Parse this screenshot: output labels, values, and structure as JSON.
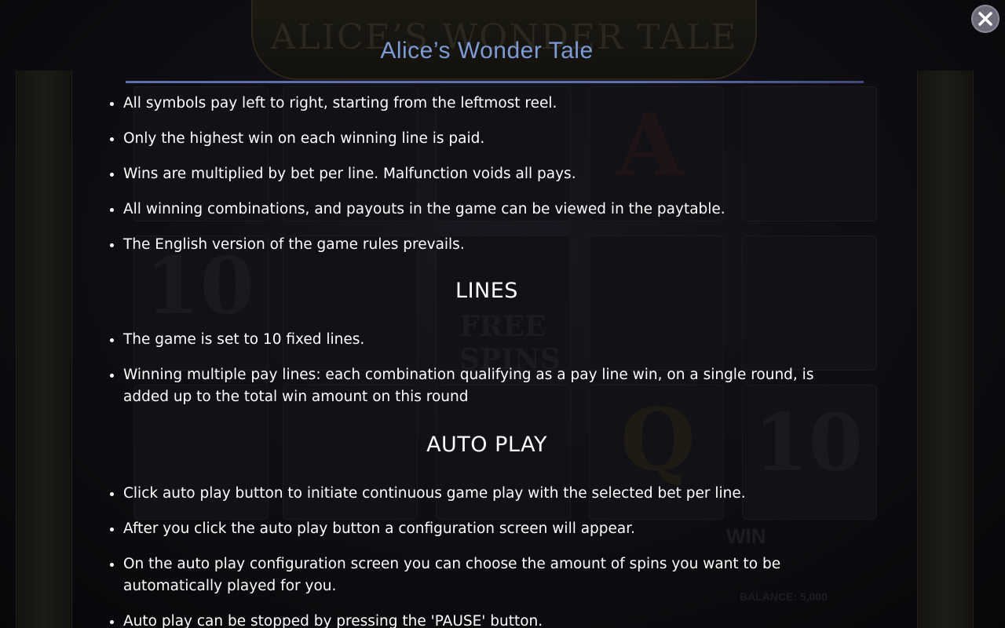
{
  "window": {
    "title": "Alice’s Wonder Tale"
  },
  "icons": {
    "close": "close-icon"
  },
  "colors": {
    "title": "#7b9ad6",
    "rule": "#5e6fae",
    "text": "#ffffff",
    "background": "#0b0a0d"
  },
  "rules": {
    "general": [
      "All symbols pay left to right, starting from the leftmost reel.",
      "Only the highest win on each winning line is paid.",
      "Wins are multiplied by bet per line. Malfunction voids all pays.",
      "All winning combinations, and payouts in the game can be viewed in the paytable.",
      "The English version of the game rules prevails."
    ],
    "lines_heading": "LINES",
    "lines": [
      "The game is set to 10 fixed lines.",
      "Winning multiple pay lines: each combination qualifying as a pay line win, on a single round, is added up to the total win amount on this round"
    ],
    "autoplay_heading": "AUTO PLAY",
    "autoplay": [
      "Click auto play button to initiate continuous game play with the selected bet per line.",
      "After you click the auto play button a configuration screen will appear.",
      "On the auto play configuration screen you can choose the amount of spins you want to be automatically played for you.",
      "Auto play can be stopped by pressing the 'PAUSE' button."
    ]
  }
}
